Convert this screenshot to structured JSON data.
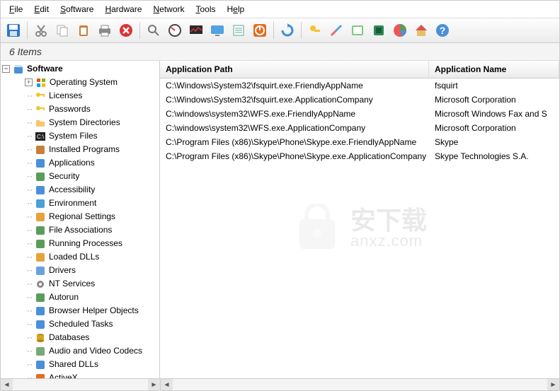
{
  "menu": [
    "File",
    "Edit",
    "Software",
    "Hardware",
    "Network",
    "Tools",
    "Help"
  ],
  "statusbar": "6 Items",
  "tree": {
    "root": "Software",
    "items": [
      {
        "label": "Operating System",
        "icon": "win",
        "expandable": true
      },
      {
        "label": "Licenses",
        "icon": "key"
      },
      {
        "label": "Passwords",
        "icon": "pkey"
      },
      {
        "label": "System Directories",
        "icon": "folder"
      },
      {
        "label": "System Files",
        "icon": "cmd"
      },
      {
        "label": "Installed Programs",
        "icon": "box"
      },
      {
        "label": "Applications",
        "icon": "apps"
      },
      {
        "label": "Security",
        "icon": "shield"
      },
      {
        "label": "Accessibility",
        "icon": "access"
      },
      {
        "label": "Environment",
        "icon": "globe"
      },
      {
        "label": "Regional Settings",
        "icon": "region"
      },
      {
        "label": "File Associations",
        "icon": "assoc"
      },
      {
        "label": "Running Processes",
        "icon": "proc"
      },
      {
        "label": "Loaded DLLs",
        "icon": "dll"
      },
      {
        "label": "Drivers",
        "icon": "driver"
      },
      {
        "label": "NT Services",
        "icon": "gear"
      },
      {
        "label": "Autorun",
        "icon": "autorun"
      },
      {
        "label": "Browser Helper Objects",
        "icon": "bho"
      },
      {
        "label": "Scheduled Tasks",
        "icon": "sched"
      },
      {
        "label": "Databases",
        "icon": "db"
      },
      {
        "label": "Audio and Video Codecs",
        "icon": "codec"
      },
      {
        "label": "Shared DLLs",
        "icon": "sdll"
      },
      {
        "label": "ActiveX",
        "icon": "ax"
      }
    ]
  },
  "list": {
    "headers": {
      "path": "Application Path",
      "name": "Application Name"
    },
    "rows": [
      {
        "path": "C:\\Windows\\System32\\fsquirt.exe.FriendlyAppName",
        "name": "fsquirt"
      },
      {
        "path": "C:\\Windows\\System32\\fsquirt.exe.ApplicationCompany",
        "name": "Microsoft Corporation"
      },
      {
        "path": "C:\\windows\\system32\\WFS.exe.FriendlyAppName",
        "name": "Microsoft  Windows Fax and S"
      },
      {
        "path": "C:\\windows\\system32\\WFS.exe.ApplicationCompany",
        "name": "Microsoft Corporation"
      },
      {
        "path": "C:\\Program Files (x86)\\Skype\\Phone\\Skype.exe.FriendlyAppName",
        "name": "Skype"
      },
      {
        "path": "C:\\Program Files (x86)\\Skype\\Phone\\Skype.exe.ApplicationCompany",
        "name": "Skype Technologies S.A."
      }
    ]
  },
  "watermark": {
    "cn": "安下载",
    "en": "anxz.com"
  }
}
